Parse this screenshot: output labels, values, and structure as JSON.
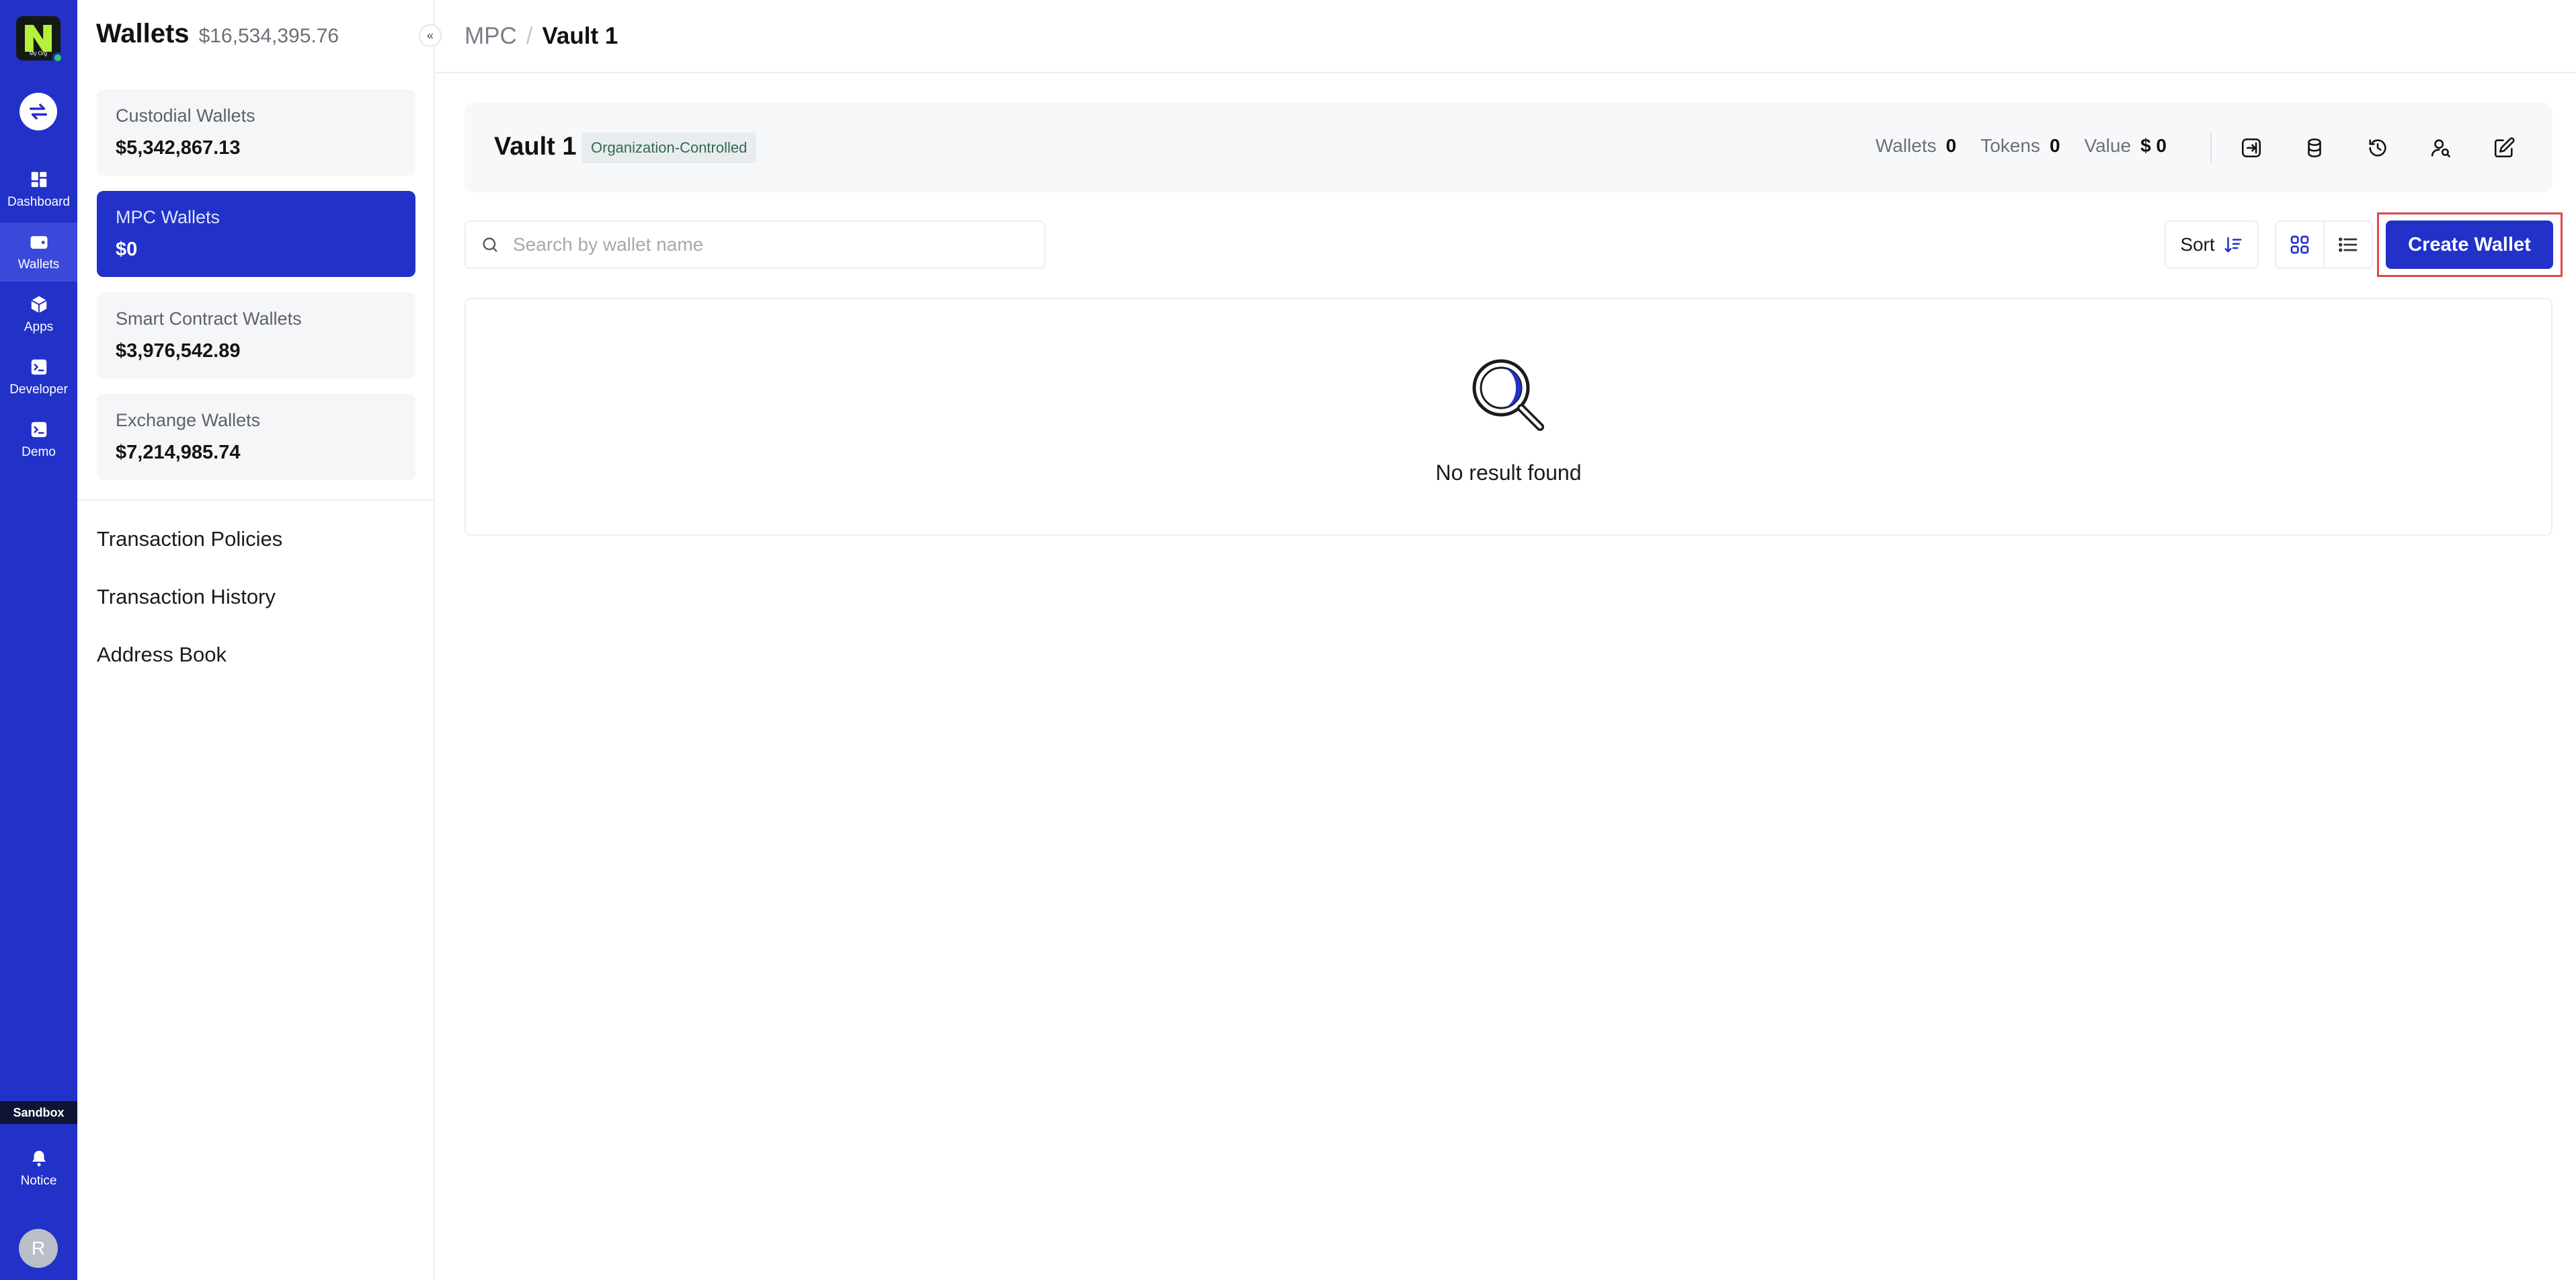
{
  "rail": {
    "logo_text": "My Org",
    "items": [
      {
        "label": "Dashboard",
        "icon": "dashboard-icon"
      },
      {
        "label": "Wallets",
        "icon": "wallet-icon",
        "active": true
      },
      {
        "label": "Apps",
        "icon": "cube-icon"
      },
      {
        "label": "Developer",
        "icon": "terminal-icon"
      },
      {
        "label": "Demo",
        "icon": "terminal-icon"
      }
    ],
    "sandbox": "Sandbox",
    "notice": "Notice",
    "avatar": "R"
  },
  "sidebar": {
    "title": "Wallets",
    "total": "$16,534,395.76",
    "cards": [
      {
        "label": "Custodial Wallets",
        "value": "$5,342,867.13"
      },
      {
        "label": "MPC Wallets",
        "value": "$0",
        "active": true
      },
      {
        "label": "Smart Contract Wallets",
        "value": "$3,976,542.89"
      },
      {
        "label": "Exchange Wallets",
        "value": "$7,214,985.74"
      }
    ],
    "links": [
      "Transaction Policies",
      "Transaction History",
      "Address Book"
    ]
  },
  "breadcrumb": {
    "parent": "MPC",
    "separator": "/",
    "current": "Vault 1"
  },
  "vault": {
    "name": "Vault 1",
    "tag": "Organization-Controlled",
    "stats": {
      "wallets_label": "Wallets",
      "wallets_value": "0",
      "tokens_label": "Tokens",
      "tokens_value": "0",
      "value_label": "Value",
      "value_value": "$ 0"
    },
    "actions": [
      "login-icon",
      "coins-icon",
      "history-icon",
      "user-search-icon",
      "edit-icon"
    ]
  },
  "toolbar": {
    "search_placeholder": "Search by wallet name",
    "sort_label": "Sort",
    "create_label": "Create Wallet"
  },
  "empty": {
    "message": "No result found"
  },
  "colors": {
    "accent": "#2231c8",
    "highlight": "#e04848"
  }
}
